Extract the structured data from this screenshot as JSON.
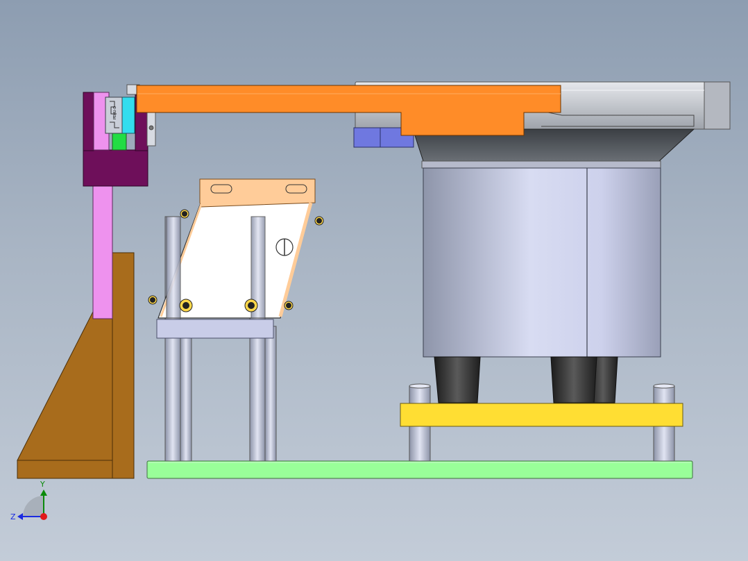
{
  "triad": {
    "y_label": "Y",
    "z_label": "Z"
  },
  "rail_label": "PEHU-D",
  "colors": {
    "arm": "#ff8c28",
    "lift_column": "#ee92ee",
    "bracket_block": "#6e0f5a",
    "angle_bracket": "#a86c1c",
    "base_plate": "#99ff99",
    "yellow_plate": "#ffde33",
    "cyan_part": "#33ddee",
    "green_part": "#22dd44",
    "bowl_gray": "#bfc3cc",
    "slider_blue": "#6f78e0"
  }
}
